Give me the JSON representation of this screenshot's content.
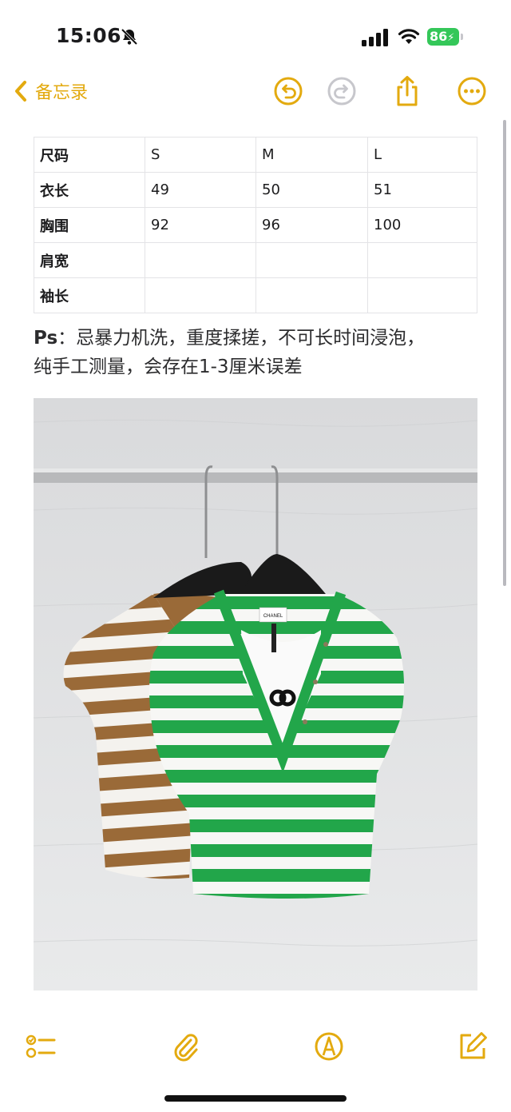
{
  "status": {
    "time": "15:06",
    "battery": "86"
  },
  "nav": {
    "back_label": "备忘录"
  },
  "size_table": {
    "rows": [
      [
        "尺码",
        "S",
        "M",
        "L"
      ],
      [
        "衣长",
        "49",
        "50",
        "51"
      ],
      [
        "胸围",
        "92",
        "96",
        "100"
      ],
      [
        "肩宽",
        "",
        "",
        ""
      ],
      [
        "袖长",
        "",
        "",
        ""
      ]
    ]
  },
  "note": {
    "ps_label": "Ps",
    "line1": "：忌暴力机洗，重度揉搓，不可长时间浸泡，",
    "line2": "纯手工测量，会存在1-3厘米误差"
  },
  "photo": {
    "tag_text": "CHANEL"
  },
  "colors": {
    "accent": "#e3aa0f",
    "green_stripe": "#22a64a",
    "brown_stripe": "#9a6a38"
  }
}
